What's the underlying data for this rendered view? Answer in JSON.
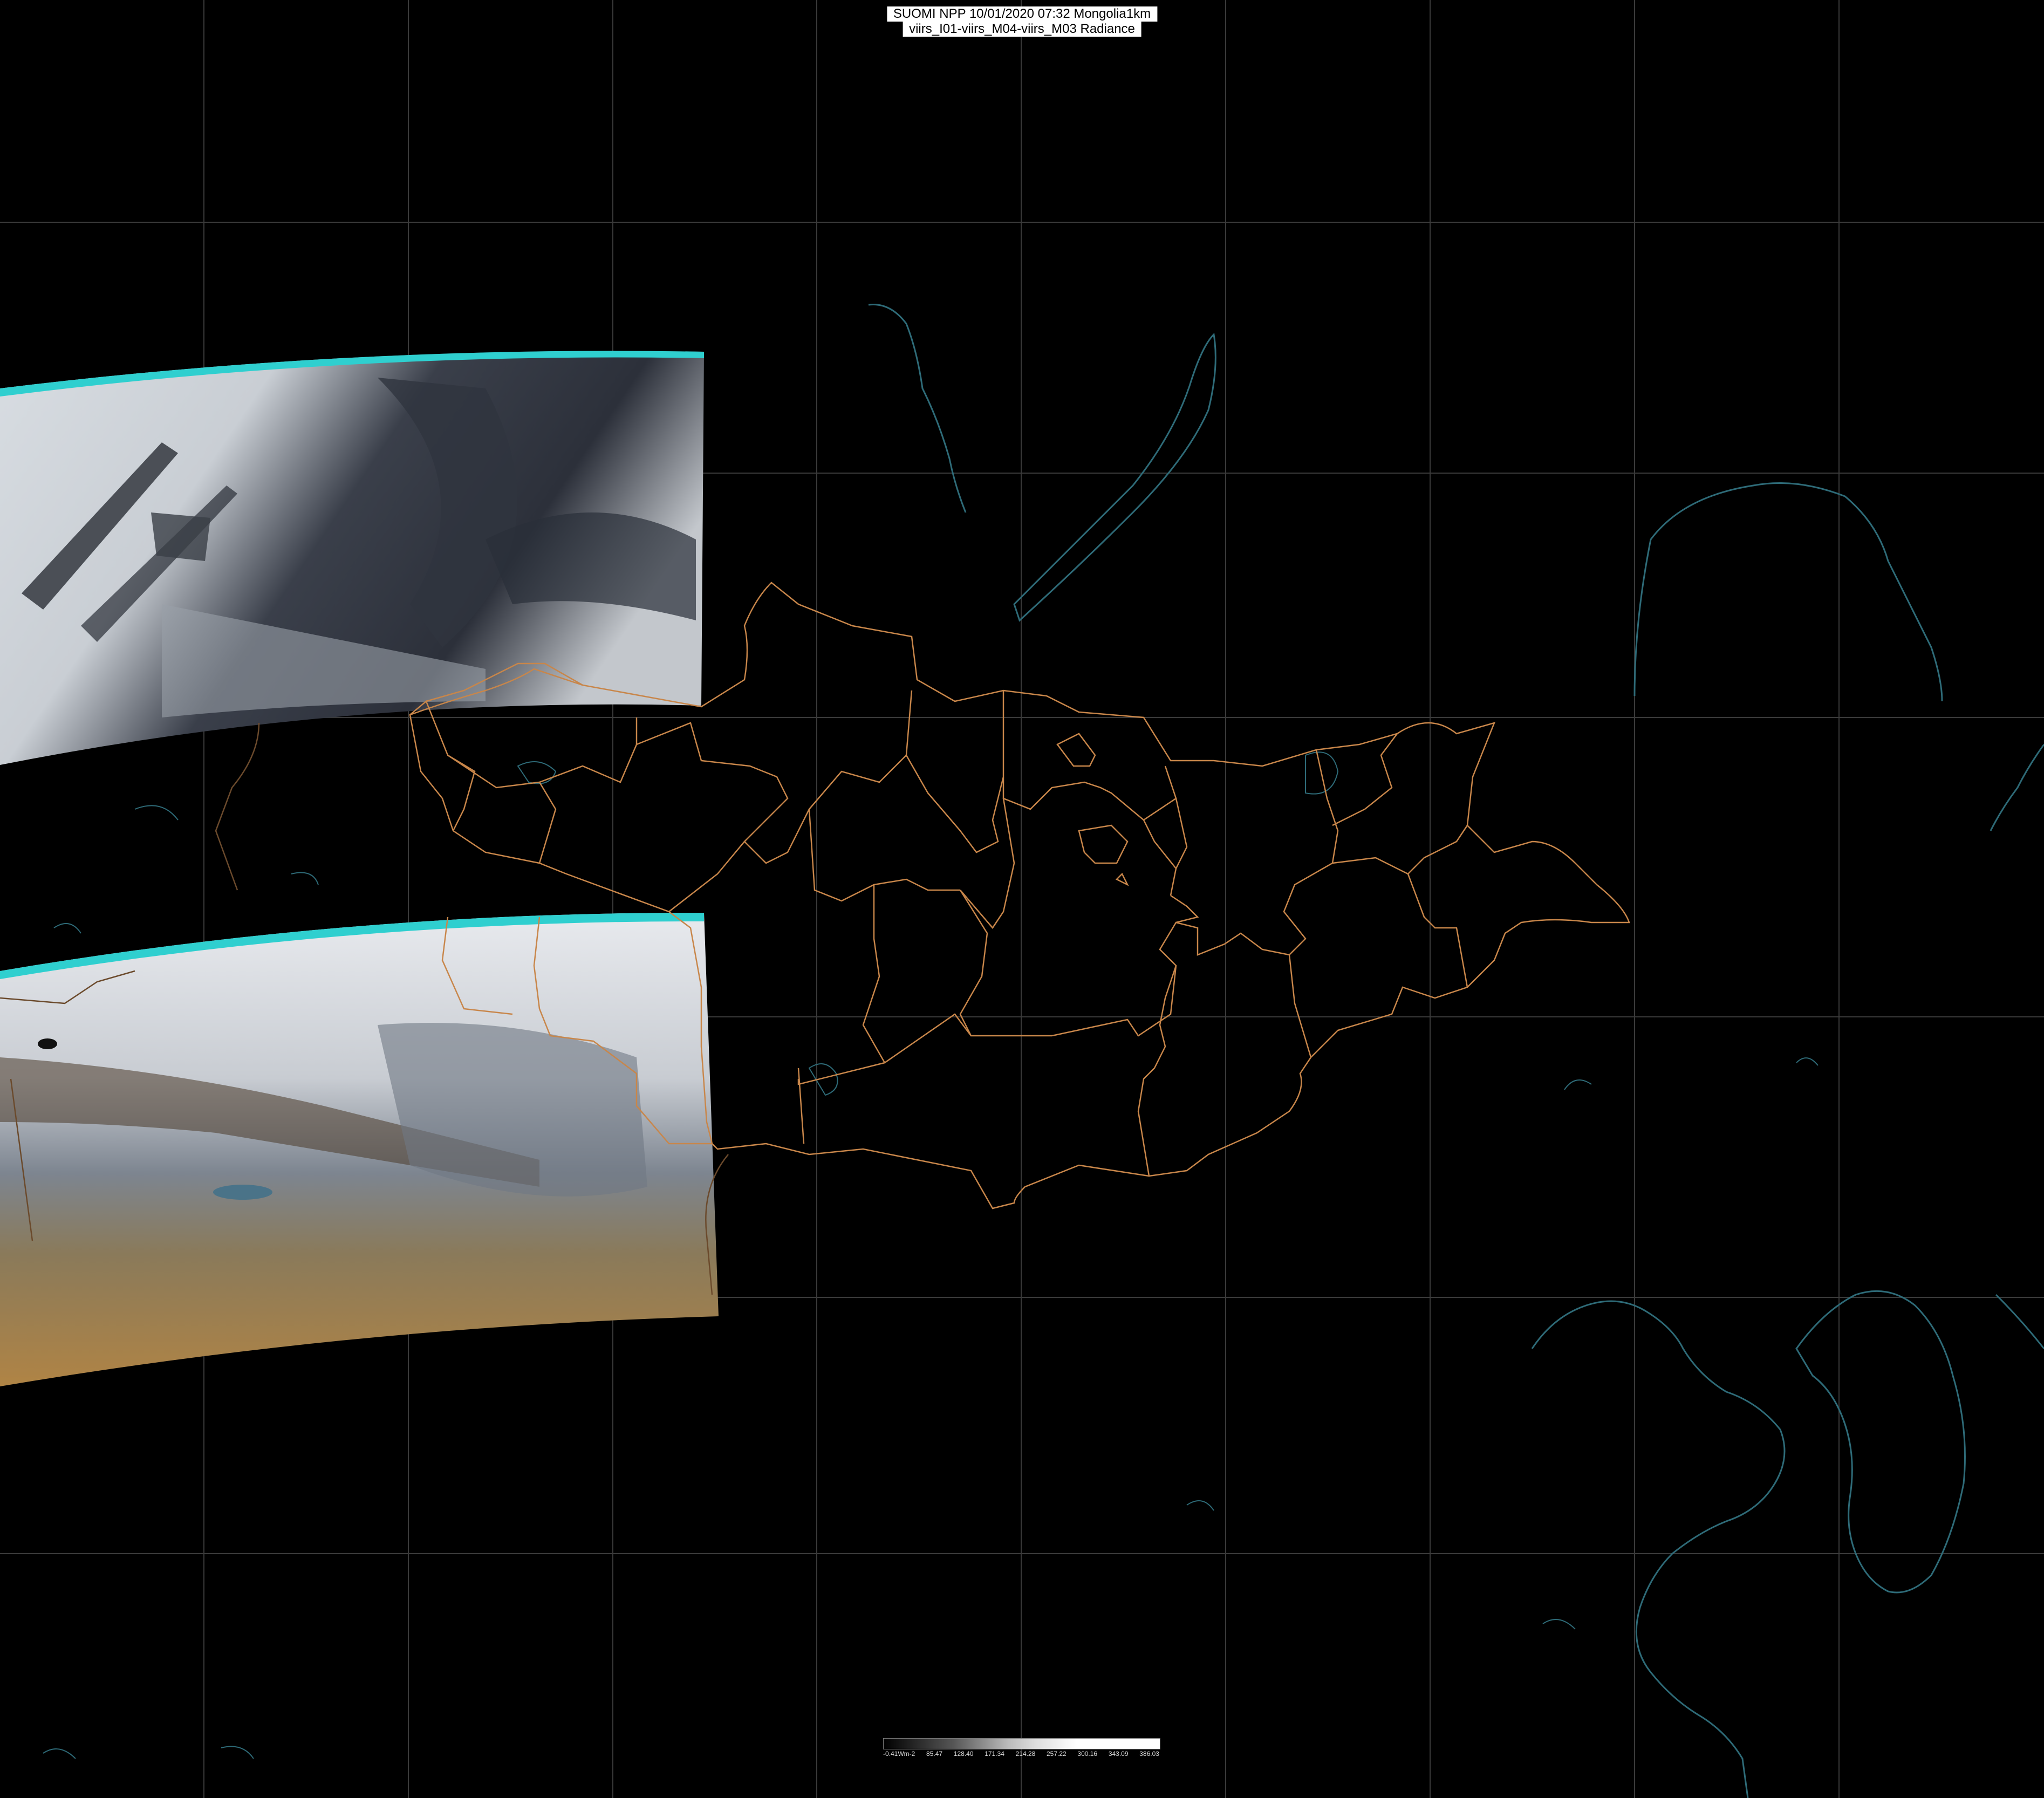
{
  "header": {
    "line1": "SUOMI NPP 10/01/2020 07:32 Mongolia1km",
    "line2": "viirs_I01-viirs_M04-viirs_M03 Radiance"
  },
  "colorbar": {
    "labels": [
      "-0.41Wm-2",
      "85.47",
      "128.40",
      "171.34",
      "214.28",
      "257.22",
      "300.16",
      "343.09",
      "386.03"
    ]
  },
  "colors": {
    "background": "#000000",
    "grid": "#3a3a3a",
    "border": "#c8864a",
    "coast": "#2e6b78",
    "swath_edge": "#2fcfcf"
  },
  "map": {
    "projection_note": "",
    "graticule": "on"
  }
}
